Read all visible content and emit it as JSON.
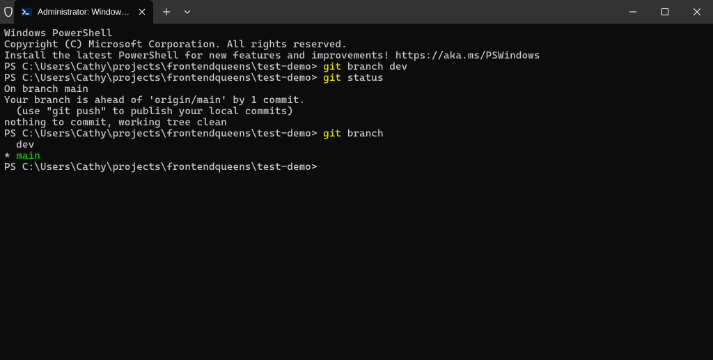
{
  "titlebar": {
    "tab_title": "Administrator: Windows Powe"
  },
  "terminal": {
    "header1": "Windows PowerShell",
    "header2": "Copyright (C) Microsoft Corporation. All rights reserved.",
    "blank": "",
    "install_msg": "Install the latest PowerShell for new features and improvements! https://aka.ms/PSWindows",
    "prompt": "PS C:\\Users\\Cathy\\projects\\frontendqueens\\test-demo> ",
    "cmd1_name": "git",
    "cmd1_args": " branch dev",
    "cmd2_name": "git",
    "cmd2_args": " status",
    "status1": "On branch main",
    "status2": "Your branch is ahead of 'origin/main' by 1 commit.",
    "status3": "  (use \"git push\" to publish your local commits)",
    "status4": "nothing to commit, working tree clean",
    "cmd3_name": "git",
    "cmd3_args": " branch",
    "branch1": "  dev",
    "branch2_prefix": "* ",
    "branch2_name": "main"
  }
}
